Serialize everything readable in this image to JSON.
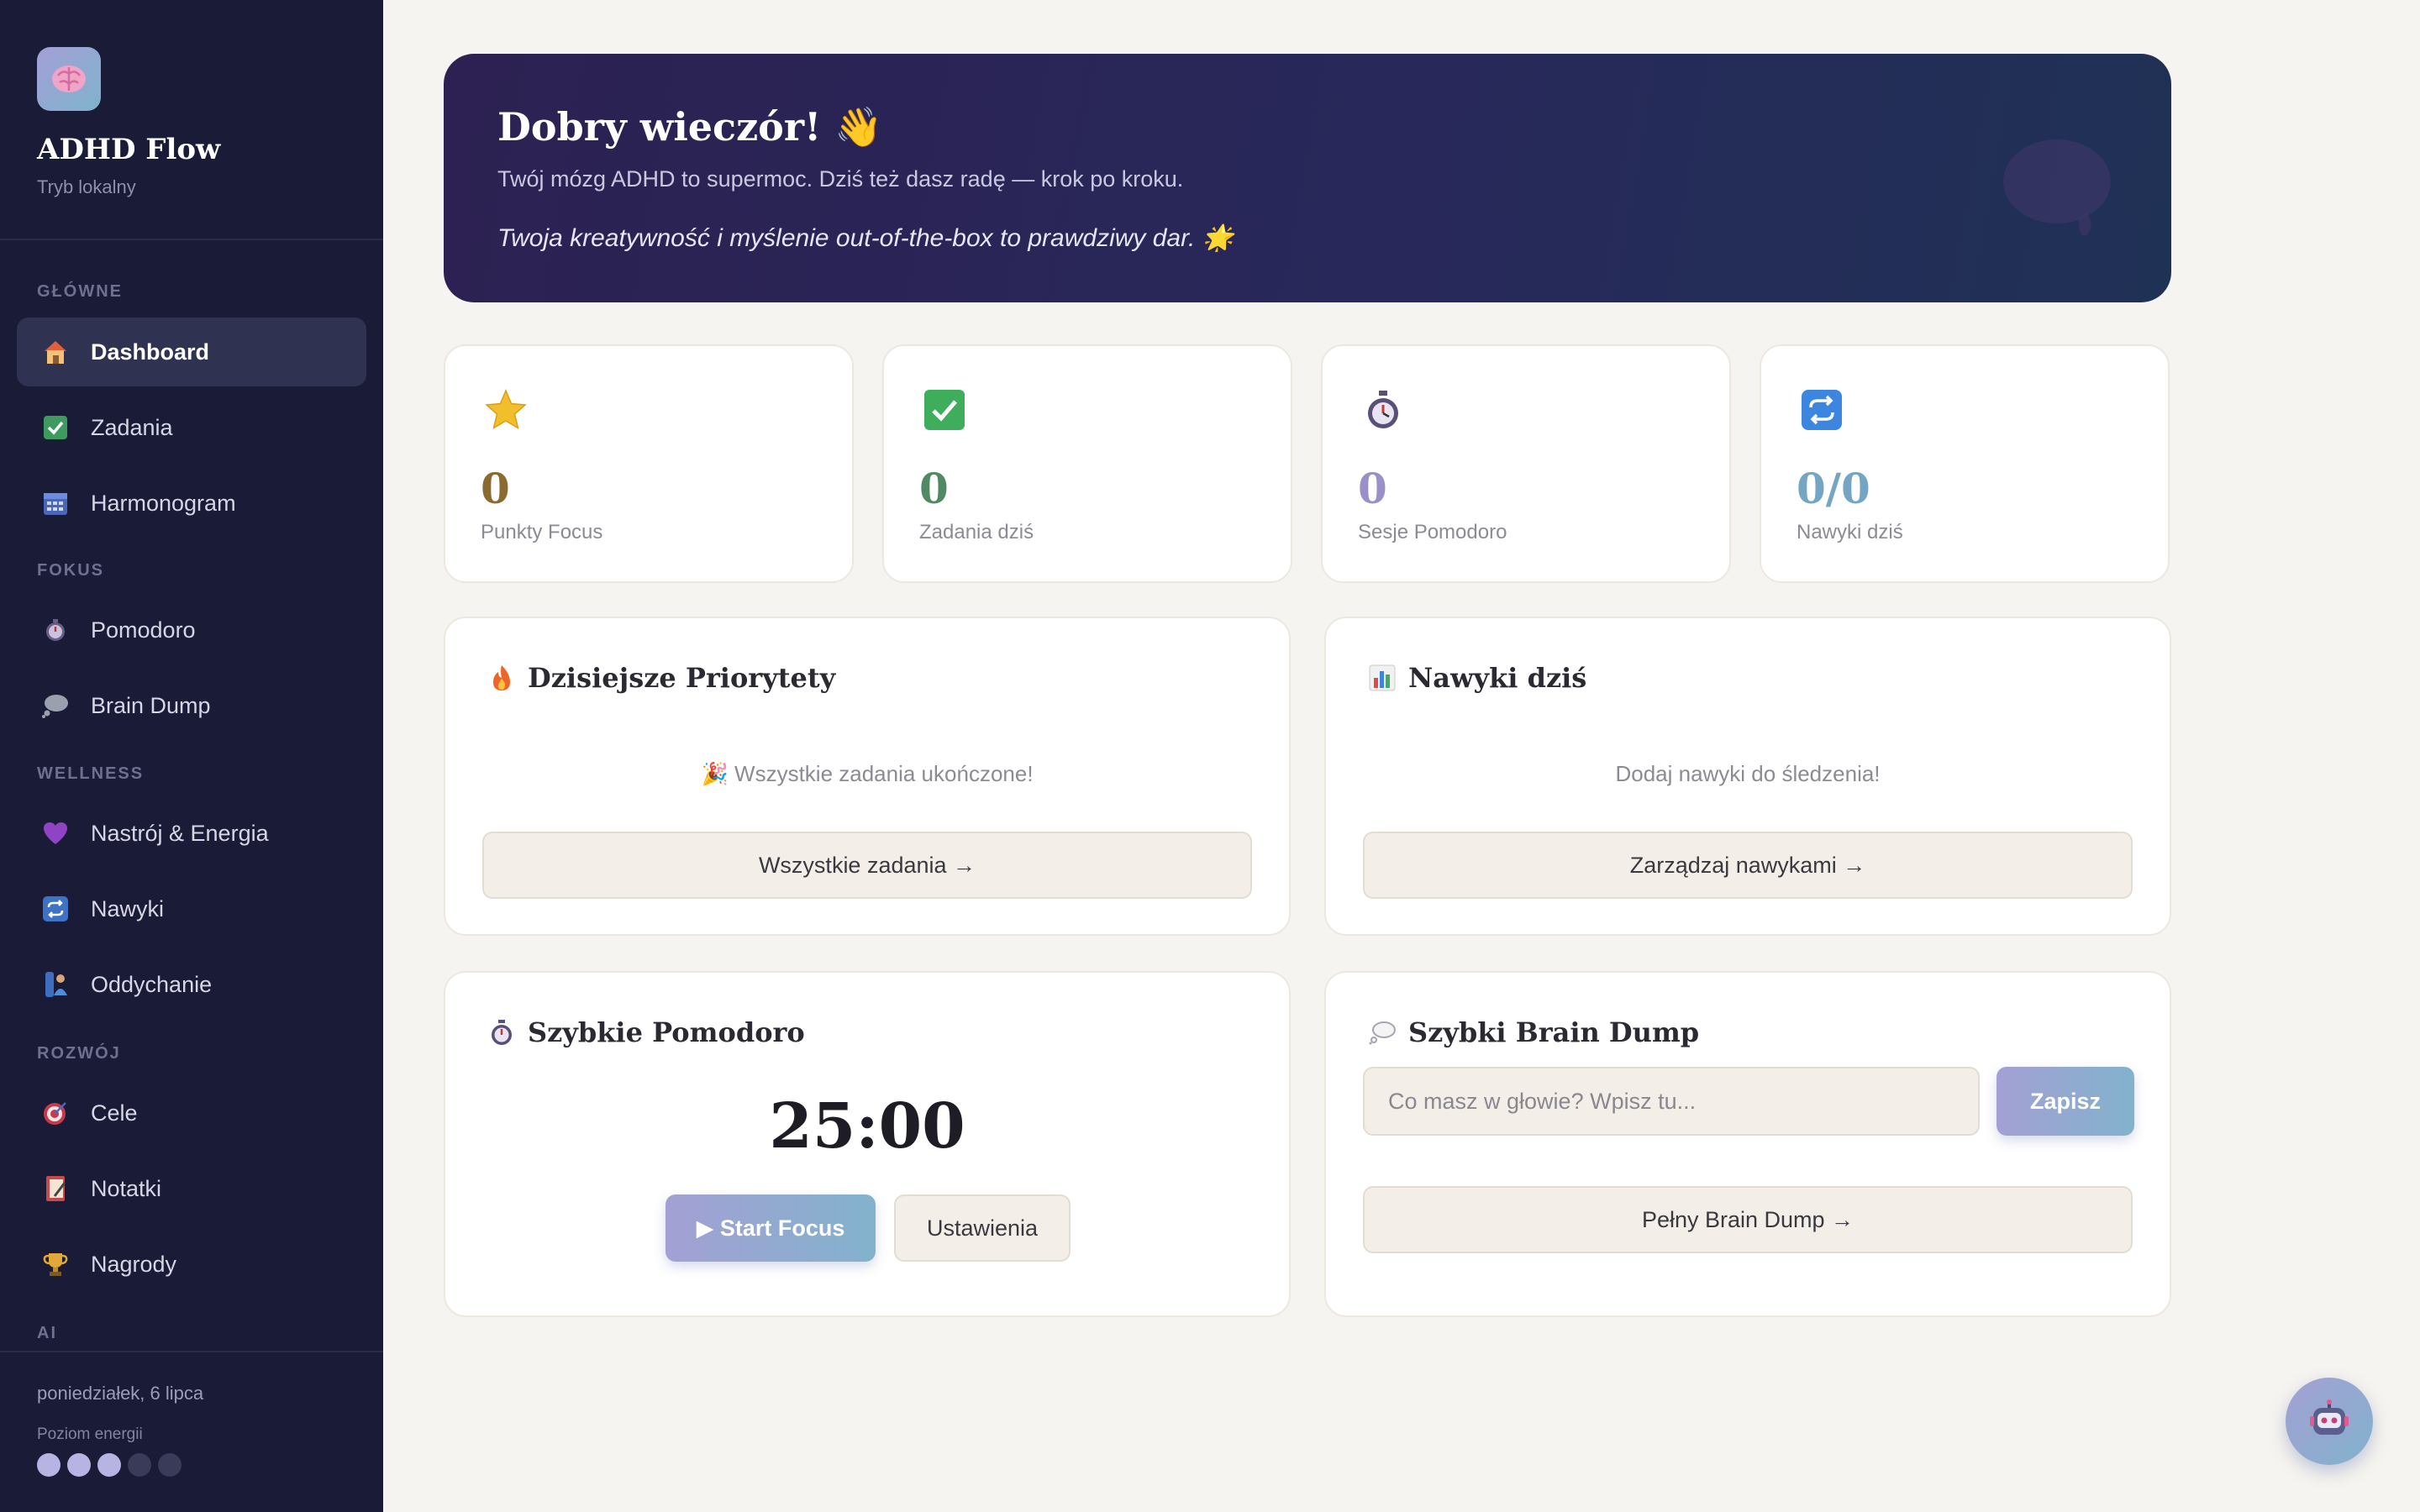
{
  "sidebar": {
    "app_title": "ADHD Flow",
    "app_subtitle": "Tryb lokalny",
    "sections": {
      "main": "GŁÓWNE",
      "focus": "FOKUS",
      "wellness": "WELLNESS",
      "growth": "ROZWÓJ",
      "ai": "AI"
    },
    "items": {
      "dashboard": "Dashboard",
      "tasks": "Zadania",
      "schedule": "Harmonogram",
      "pomodoro": "Pomodoro",
      "brain_dump": "Brain Dump",
      "mood": "Nastrój & Energia",
      "habits": "Nawyki",
      "breathing": "Oddychanie",
      "goals": "Cele",
      "notes": "Notatki",
      "rewards": "Nagrody"
    },
    "date": "poniedziałek, 6 lipca",
    "energy_label": "Poziom energii",
    "energy_level": 3,
    "energy_max": 5
  },
  "hero": {
    "title": "Dobry wieczór! 👋",
    "subtitle": "Twój mózg ADHD to supermoc. Dziś też dasz radę — krok po kroku.",
    "quote": "Twoja kreatywność i myślenie out-of-the-box to prawdziwy dar. 🌟"
  },
  "stats": {
    "focus_points": {
      "value": "0",
      "label": "Punkty Focus",
      "color": "#8a6a2e"
    },
    "tasks_today": {
      "value": "0",
      "label": "Zadania dziś",
      "color": "#4f8a62"
    },
    "pomodoro_sessions": {
      "value": "0",
      "label": "Sesje Pomodoro",
      "color": "#9b8fc8"
    },
    "habits_today": {
      "value": "0/0",
      "label": "Nawyki dziś",
      "color": "#74a6c4"
    }
  },
  "priorities": {
    "title": "Dzisiejsze Priorytety",
    "empty": "🎉 Wszystkie zadania ukończone!",
    "button": "Wszystkie zadania →"
  },
  "habits_card": {
    "title": "Nawyki dziś",
    "empty": "Dodaj nawyki do śledzenia!",
    "button": "Zarządzaj nawykami →"
  },
  "quick_pomodoro": {
    "title": "Szybkie Pomodoro",
    "timer": "25:00",
    "start": "▶ Start Focus",
    "settings": "Ustawienia"
  },
  "quick_brain_dump": {
    "title": "Szybki Brain Dump",
    "placeholder": "Co masz w głowie? Wpisz tu...",
    "value": "",
    "save": "Zapisz",
    "full": "Pełny Brain Dump →"
  },
  "colors": {
    "sidebar_bg": "#1a1b36",
    "accent_gradient_start": "#a3a0d4",
    "accent_gradient_end": "#82b2cc",
    "page_bg": "#f6f4f0"
  }
}
